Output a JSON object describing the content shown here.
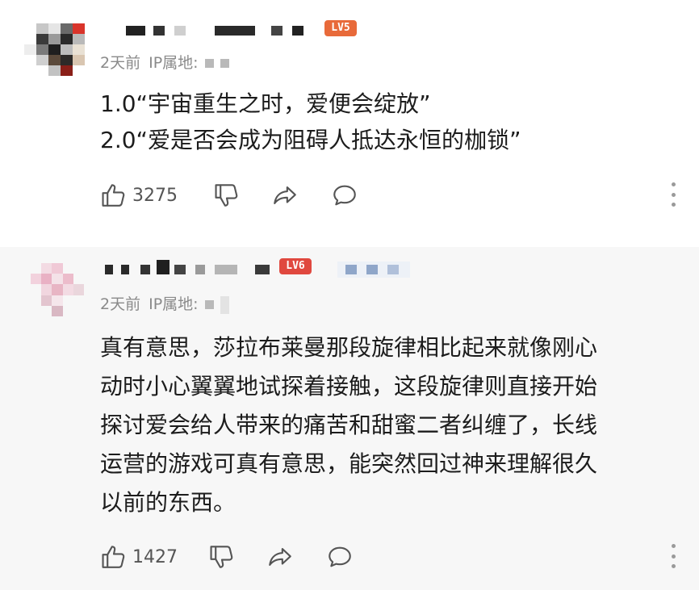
{
  "comments": [
    {
      "level_badge": "LV5",
      "level_color": "#e86a3a",
      "time": "2天前",
      "ip_label": "IP属地:",
      "lines": [
        "1.0“宇宙重生之时，爱便会绽放”",
        "2.0“爱是否会成为阻碍人抵达永恒的枷锁”"
      ],
      "likes": "3275",
      "icons": [
        "thumbs-up-icon",
        "thumbs-down-icon",
        "share-icon",
        "comment-icon",
        "more-icon"
      ]
    },
    {
      "level_badge": "LV6",
      "level_color": "#e0483f",
      "time": "2天前",
      "ip_label": "IP属地:",
      "lines": [
        "真有意思，莎拉布莱曼那段旋律相比起来就像刚心",
        "动时小心翼翼地试探着接触，这段旋律则直接开始",
        "探讨爱会给人带来的痛苦和甜蜜二者纠缠了，长线",
        "运营的游戏可真有意思，能突然回过神来理解很久",
        "以前的东西。"
      ],
      "likes": "1427",
      "icons": [
        "thumbs-up-icon",
        "thumbs-down-icon",
        "share-icon",
        "comment-icon",
        "more-icon"
      ]
    }
  ],
  "colors": {
    "meta_text": "#8a8a8a",
    "body_text": "#1c1c1c",
    "icon": "#555555"
  }
}
